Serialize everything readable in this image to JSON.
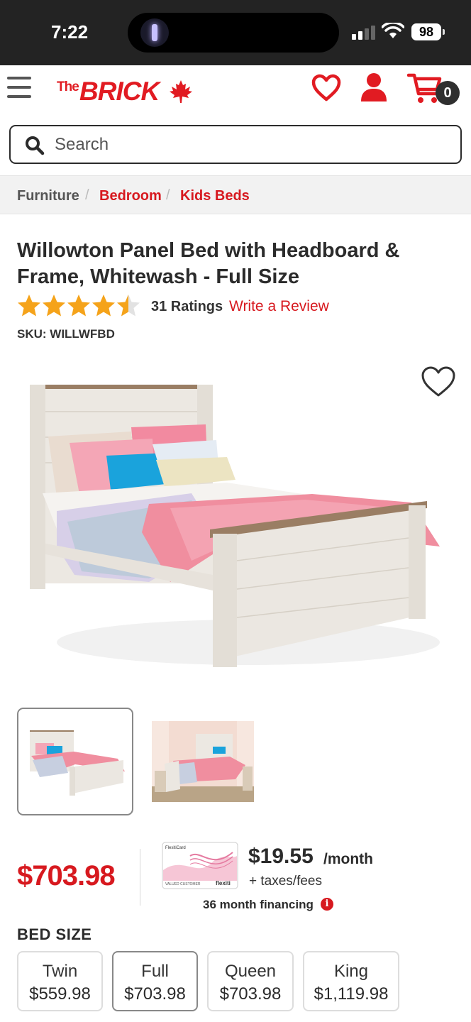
{
  "status_bar": {
    "time": "7:22",
    "battery": "98"
  },
  "header": {
    "logo_the": "The",
    "logo_brick": "BRICK",
    "cart_count": "0"
  },
  "search": {
    "placeholder": "Search"
  },
  "breadcrumb": [
    {
      "label": "Furniture"
    },
    {
      "label": "Bedroom"
    },
    {
      "label": "Kids Beds"
    }
  ],
  "breadcrumb_separator": "/",
  "product": {
    "title": "Willowton Panel Bed with Headboard & Frame, Whitewash - Full Size",
    "rating": 4.5,
    "ratings_count": "31 Ratings",
    "write_review": "Write a Review",
    "sku": "SKU: WILLWFBD",
    "price": "$703.98"
  },
  "financing": {
    "amount": "$19.55",
    "per": "/month",
    "taxes": "+ taxes/fees",
    "term": "36 month financing",
    "card_brand": "flexiti",
    "card_label": "FlexitiCard",
    "card_holder": "VALUED CUSTOMER"
  },
  "bed_size": {
    "heading": "BED SIZE",
    "options": [
      {
        "label": "Twin",
        "price": "$559.98",
        "selected": false
      },
      {
        "label": "Full",
        "price": "$703.98",
        "selected": true
      },
      {
        "label": "Queen",
        "price": "$703.98",
        "selected": false
      },
      {
        "label": "King",
        "price": "$1,119.98",
        "selected": false
      }
    ]
  },
  "colors": {
    "brand_red": "#d7191f",
    "status_bar": "#232323"
  },
  "icons": [
    "menu-icon",
    "heart-icon",
    "account-icon",
    "cart-icon",
    "search-icon",
    "star-icon",
    "info-icon",
    "maple-leaf-icon"
  ]
}
